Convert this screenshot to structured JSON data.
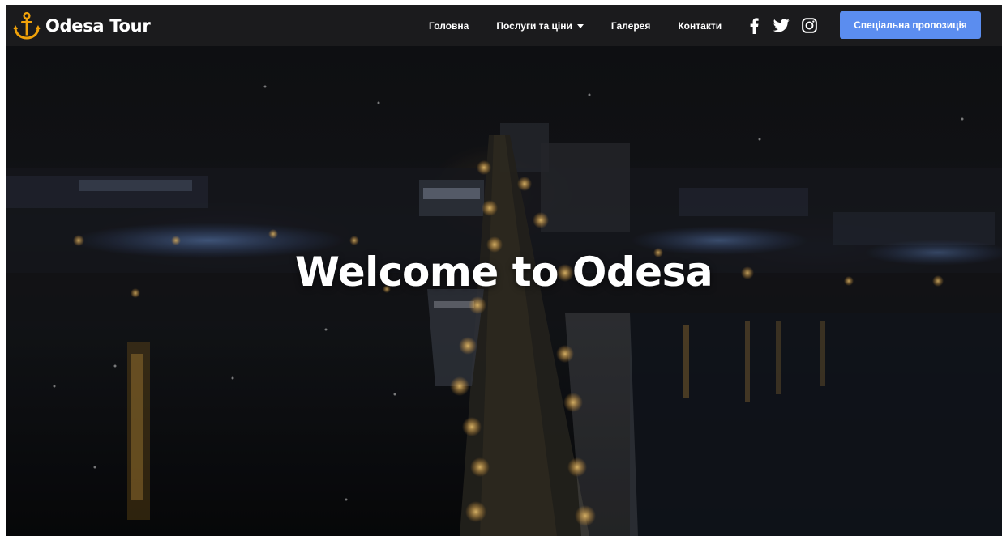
{
  "brand": {
    "name": "Odesa Tour",
    "logo_icon": "anchor-icon",
    "logo_color": "#f0a20a"
  },
  "nav": {
    "items": [
      {
        "label": "Головна"
      },
      {
        "label": "Послуги та ціни",
        "has_dropdown": true
      },
      {
        "label": "Галерея"
      },
      {
        "label": "Контакти"
      }
    ]
  },
  "social": {
    "icons": [
      "facebook-icon",
      "twitter-icon",
      "instagram-icon"
    ]
  },
  "cta": {
    "label": "Спеціальна пропозиція",
    "color": "#5b8def"
  },
  "hero": {
    "title": "Welcome to Odesa",
    "background": "night-city-aerial-image"
  },
  "colors": {
    "navbar_bg": "#1b1b1d",
    "hero_dark": "#121316",
    "accent": "#5b8def",
    "brand_gold": "#f0a20a"
  }
}
